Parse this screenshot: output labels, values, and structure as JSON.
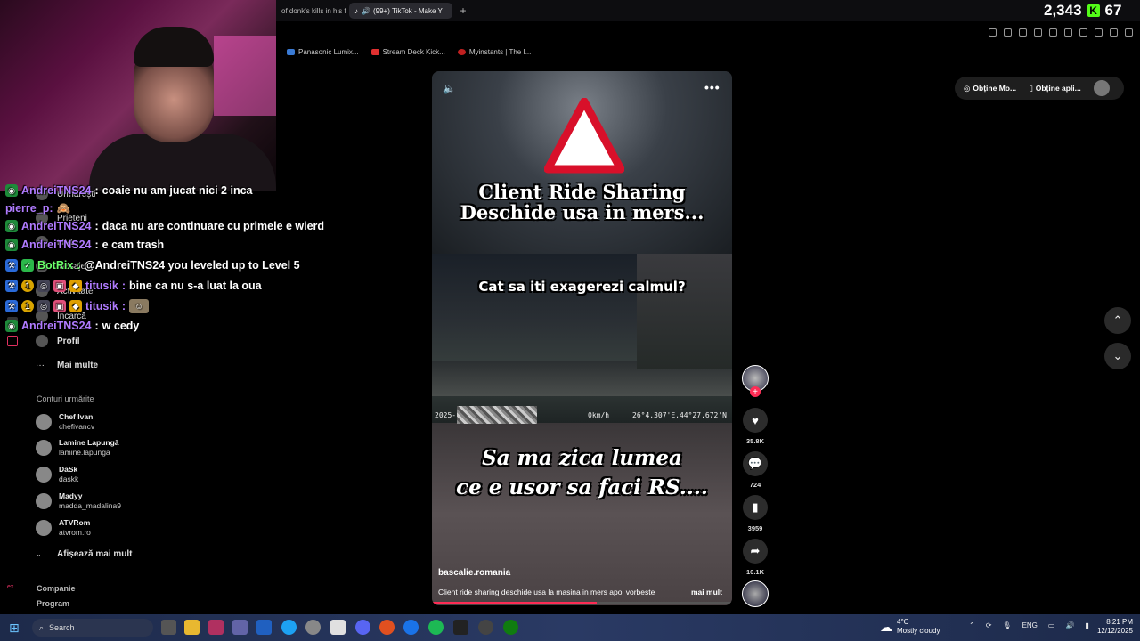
{
  "browser": {
    "tabs": [
      {
        "label": "of donk's kills in his f"
      },
      {
        "label": "(99+) TikTok - Make Y"
      }
    ],
    "new_tab_label": "+",
    "bookmarks": [
      {
        "label": "Panasonic Lumix...",
        "color": "#3a7bd5"
      },
      {
        "label": "Stream Deck Kick...",
        "color": "#e03030"
      },
      {
        "label": "Myinstants | The I...",
        "color": "#c02020"
      }
    ]
  },
  "kick_counter": {
    "viewers": "2,343",
    "logo": "K",
    "followers": "67"
  },
  "chat": [
    {
      "user": "AndreiTNS24",
      "color": "#b07bff",
      "message": "coaie nu am jucat nici 2 inca"
    },
    {
      "user": "pierre_p:",
      "color": "#b07bff",
      "message": "🙈"
    },
    {
      "user": "AndreiTNS24",
      "color": "#b07bff",
      "message": "daca nu are continuare cu primele e wierd"
    },
    {
      "user": "AndreiTNS24",
      "color": "#b07bff",
      "message": "e cam trash"
    },
    {
      "user": "BotRix",
      "color": "#6bff6b",
      "message": "@AndreiTNS24 you leveled up to Level 5"
    },
    {
      "user": "titusik",
      "color": "#b07bff",
      "message": "bine ca nu s-a luat la oua"
    },
    {
      "user": "titusik",
      "color": "#b07bff",
      "message": ""
    },
    {
      "user": "AndreiTNS24",
      "color": "#b07bff",
      "message": "w cedy"
    }
  ],
  "nav": {
    "items": [
      {
        "label": "Urmărești"
      },
      {
        "label": "Prieteni"
      },
      {
        "label": "LIVE"
      },
      {
        "label": "Mesaje"
      },
      {
        "label": "Activitate"
      },
      {
        "label": "Încarcă"
      },
      {
        "label": "Profil"
      },
      {
        "label": "Mai multe"
      }
    ],
    "following_title": "Conturi urmărite",
    "accounts": [
      {
        "name": "Chef Ivan",
        "user": "chefivancv"
      },
      {
        "name": "Lamine Lapungă",
        "user": "lamine.lapunga"
      },
      {
        "name": "DaSk",
        "user": "daskk_"
      },
      {
        "name": "Madyy",
        "user": "madda_madalina9"
      },
      {
        "name": "ATVRom",
        "user": "atvrom.ro"
      }
    ],
    "show_more": "Afișează mai mult",
    "footer": [
      "Companie",
      "Program"
    ]
  },
  "video": {
    "title_top": "Client Ride Sharing\nDeschide usa in mers...",
    "caption_mid": "Cat sa iti exagerezi calmul?",
    "caption_bottom": "Sa ma zica lumea\nce e usor sa faci RS....",
    "hud_date": "2025-",
    "hud_speed": "0km/h",
    "hud_coords": "26°4.307'E,44°27.672'N",
    "author": "bascalie.romania",
    "description": "Client ride sharing deschide usa la masina in mers apoi vorbeste",
    "more_label": "mai mult",
    "progress": 0.55,
    "menu_label": "•••"
  },
  "actions": {
    "likes": "35.8K",
    "comments": "724",
    "saves": "3959",
    "shares": "10.1K"
  },
  "top_pills": {
    "get_mode": "Obține Mo...",
    "get_app": "Obține apli..."
  },
  "taskbar": {
    "search_placeholder": "Search",
    "weather_temp": "4°C",
    "weather_desc": "Mostly cloudy",
    "language": "ENG",
    "time": "8:21 PM",
    "date": "12/12/2025"
  }
}
